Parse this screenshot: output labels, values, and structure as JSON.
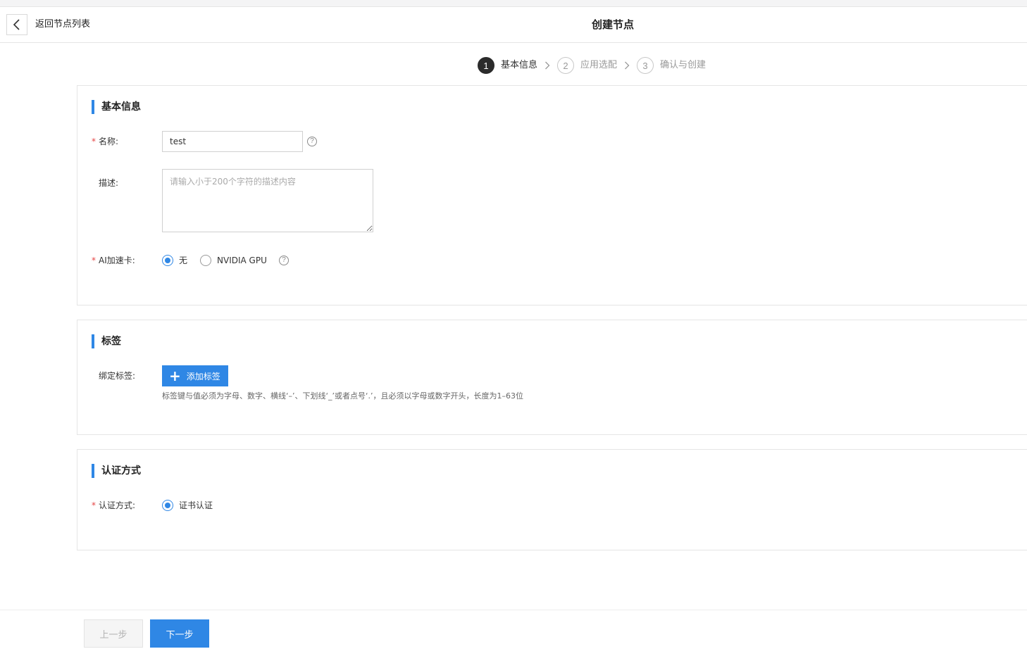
{
  "header": {
    "back_label": "返回节点列表",
    "title": "创建节点"
  },
  "steps": [
    {
      "number": "1",
      "label": "基本信息",
      "active": true
    },
    {
      "number": "2",
      "label": "应用选配",
      "active": false
    },
    {
      "number": "3",
      "label": "确认与创建",
      "active": false
    }
  ],
  "basic_info": {
    "title": "基本信息",
    "name_label": "名称:",
    "name_value": "test",
    "description_label": "描述:",
    "description_placeholder": "请输入小于200个字符的描述内容",
    "ai_label": "AI加速卡:",
    "ai_options": [
      {
        "label": "无",
        "checked": true
      },
      {
        "label": "NVIDIA GPU",
        "checked": false
      }
    ],
    "required_mark": "*",
    "help_glyph": "?"
  },
  "tags": {
    "title": "标签",
    "bind_label": "绑定标签:",
    "add_button": "添加标签",
    "hint": "标签键与值必须为字母、数字、横线‘–’、下划线‘_’或者点号‘.’，且必须以字母或数字开头，长度为1–63位"
  },
  "auth": {
    "title": "认证方式",
    "label": "认证方式:",
    "options": [
      {
        "label": "证书认证",
        "checked": true
      }
    ]
  },
  "footer": {
    "prev_label": "上一步",
    "next_label": "下一步"
  },
  "colors": {
    "accent": "#2f87e5",
    "required": "#e54545"
  }
}
